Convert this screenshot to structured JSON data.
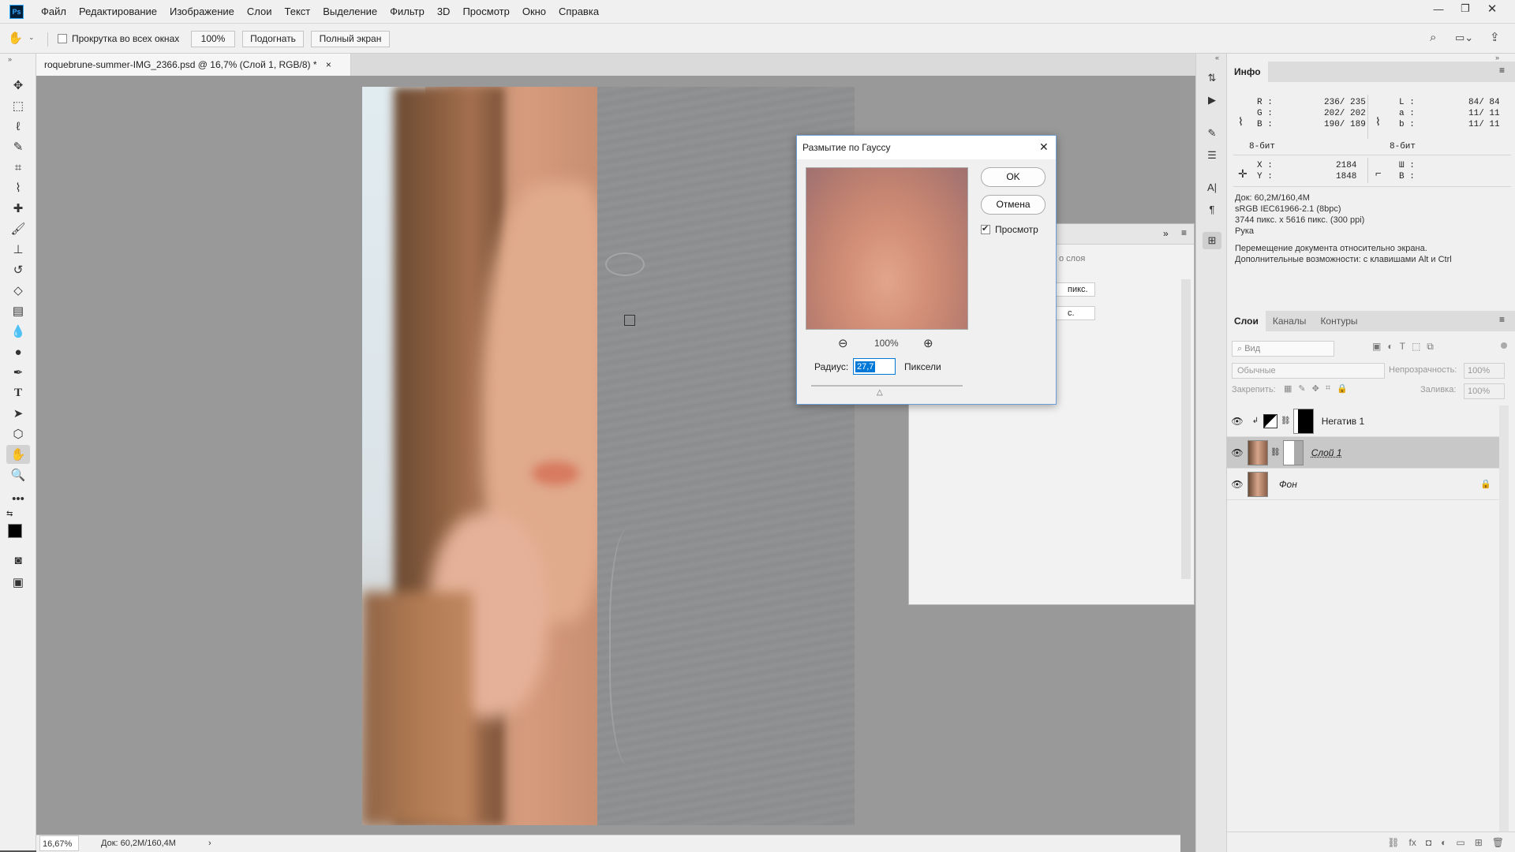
{
  "menu": {
    "logo": "Ps",
    "items": [
      "Файл",
      "Редактирование",
      "Изображение",
      "Слои",
      "Текст",
      "Выделение",
      "Фильтр",
      "3D",
      "Просмотр",
      "Окно",
      "Справка"
    ]
  },
  "options": {
    "scroll_all_label": "Прокрутка во всех окнах",
    "zoom100": "100%",
    "fit": "Подогнать",
    "fullscreen": "Полный экран"
  },
  "document": {
    "tab_title": "roquebrune-summer-IMG_2366.psd @ 16,7% (Слой 1, RGB/8) *",
    "tab_close": "×"
  },
  "status": {
    "zoom": "16,67%",
    "doc": "Док: 60,2M/160,4M",
    "arrow": "›"
  },
  "dialog": {
    "title": "Размытие по Гауссу",
    "close": "✕",
    "ok": "OK",
    "cancel": "Отмена",
    "preview_label": "Просмотр",
    "zoom": "100%",
    "radius_label": "Радиус:",
    "radius_value": "27,7",
    "units": "Пиксели"
  },
  "behind_panel": {
    "label1": "о слоя",
    "value1": "пикс.",
    "value2": "с."
  },
  "info": {
    "tab": "Инфо",
    "rgb": {
      "r_label": "R :",
      "r_val": "236/ 235",
      "g_label": "G :",
      "g_val": "202/ 202",
      "b_label": "B :",
      "b_val": "190/ 189",
      "bits": "8-бит"
    },
    "lab": {
      "l_label": "L :",
      "l_val": "84/ 84",
      "a_label": "a :",
      "a_val": "11/ 11",
      "b_label": "b :",
      "b_val": "11/ 11",
      "bits": "8-бит"
    },
    "xy": {
      "x_label": "X :",
      "x_val": "2184",
      "y_label": "Y :",
      "y_val": "1848"
    },
    "wh": {
      "w_label": "Ш :",
      "h_label": "В :"
    },
    "doc_lines": [
      "Док: 60,2M/160,4M",
      "sRGB IEC61966-2.1 (8bpc)",
      "3744 пикс. x 5616 пикс. (300 ppi)",
      "Рука"
    ],
    "hint_lines": [
      "Перемещение документа относительно экрана.",
      "Дополнительные возможности: с клавишами Alt и Ctrl"
    ]
  },
  "layers_panel": {
    "tabs": [
      "Слои",
      "Каналы",
      "Контуры"
    ],
    "search": "Вид",
    "blend": "Обычные",
    "opacity_label": "Непрозрачность:",
    "opacity": "100%",
    "lock_label": "Закрепить:",
    "fill_label": "Заливка:",
    "fill": "100%",
    "layers": [
      {
        "name": "Негатив 1"
      },
      {
        "name": "Слой 1"
      },
      {
        "name": "Фон"
      }
    ]
  },
  "colors": {
    "accent": "#0a64c8",
    "selection": "#0078d7"
  }
}
